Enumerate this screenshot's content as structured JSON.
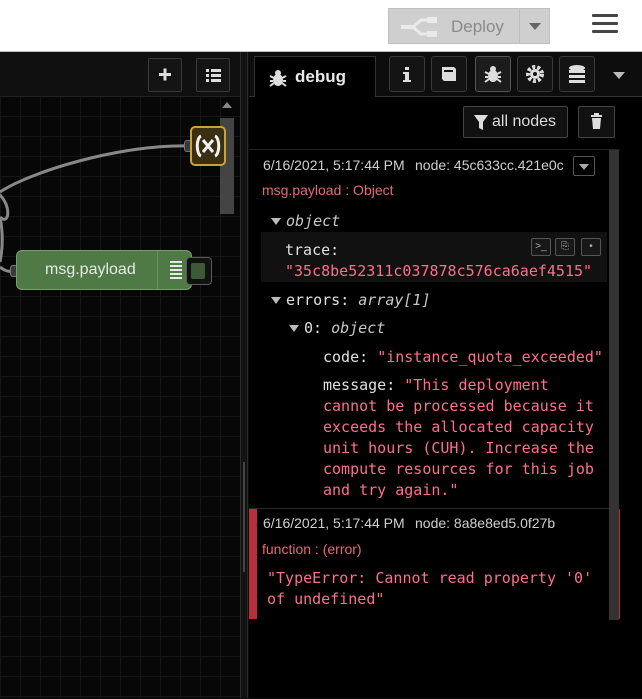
{
  "header": {
    "deploy_label": "Deploy",
    "menu_icon": "hamburger-icon"
  },
  "workspace": {
    "toolbar": {
      "add_icon": "plus-icon",
      "list_icon": "list-icon"
    },
    "debug_node_label": "msg.payload"
  },
  "sidebar": {
    "tabs": {
      "debug_label": "debug",
      "icons": [
        "info-icon",
        "book-icon",
        "bug-icon",
        "gear-icon",
        "database-icon"
      ]
    },
    "filter_label": "all nodes",
    "messages": [
      {
        "timestamp": "6/16/2021, 5:17:44 PM",
        "node": "node: 45c633cc.421e0c",
        "topic": "msg.payload : Object",
        "root_label": "object",
        "trace_key": "trace",
        "trace_value": "\"35c8be52311c037878c576ca6aef4515\"",
        "errors_key": "errors",
        "errors_type": "array[1]",
        "item_index": "0",
        "item_type": "object",
        "code_key": "code",
        "code_value": "\"instance_quota_exceeded\"",
        "message_key": "message",
        "message_lines": [
          "\"This deployment",
          "cannot be processed because it",
          "exceeds the allocated capacity",
          "unit hours (CUH). Increase the",
          "compute resources for this job",
          "and try again.\""
        ]
      },
      {
        "timestamp": "6/16/2021, 5:17:44 PM",
        "node": "node: 8a8e8ed5.0f27b",
        "topic": "function : (error)",
        "error_lines": [
          "\"TypeError: Cannot read property '0'",
          "of undefined\""
        ]
      }
    ]
  }
}
